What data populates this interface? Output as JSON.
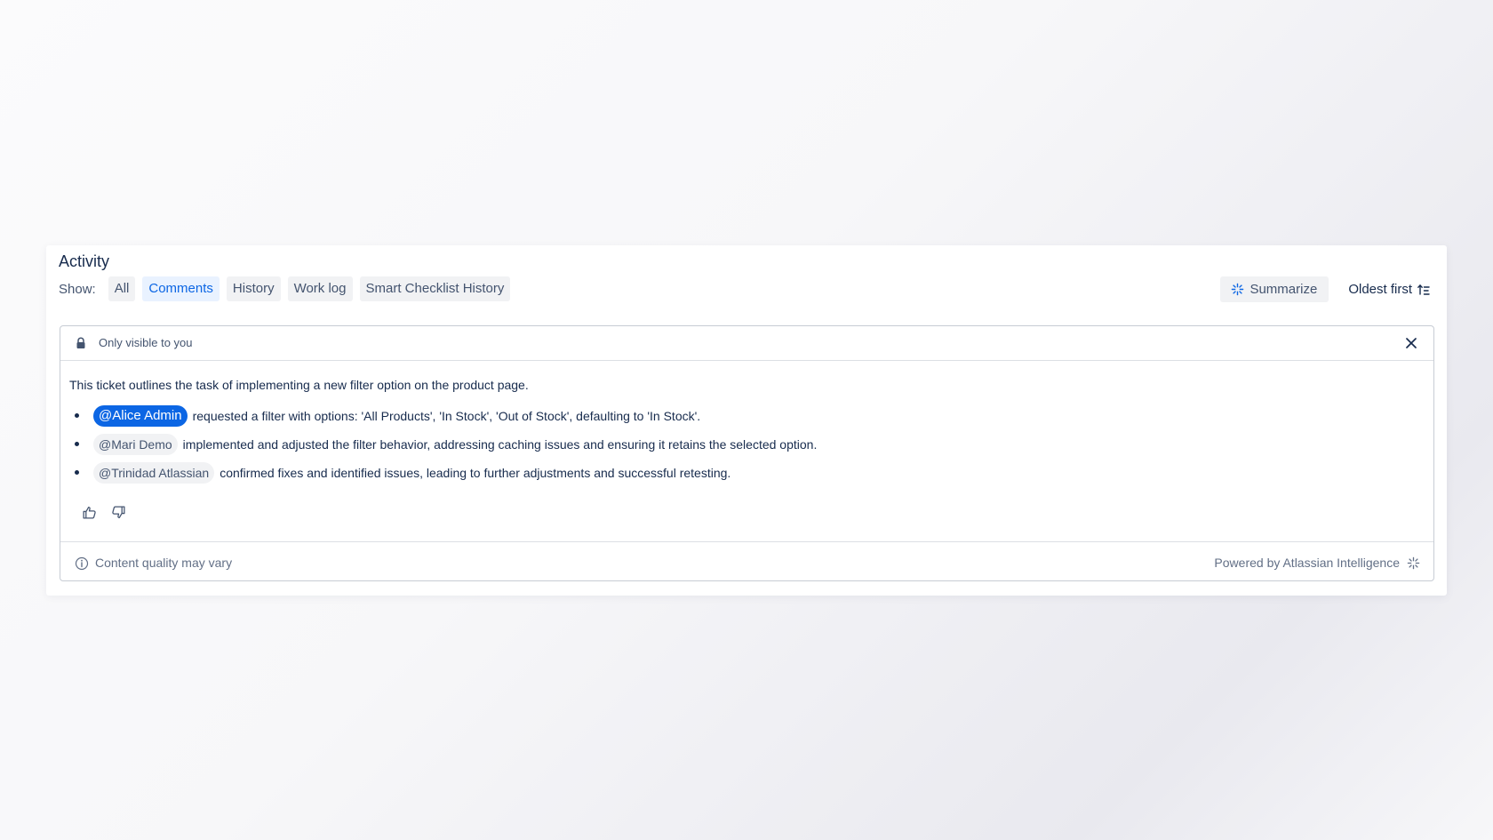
{
  "activity": {
    "title": "Activity",
    "show_label": "Show:",
    "filters": [
      {
        "label": "All",
        "active": false
      },
      {
        "label": "Comments",
        "active": true
      },
      {
        "label": "History",
        "active": false
      },
      {
        "label": "Work log",
        "active": false
      },
      {
        "label": "Smart Checklist History",
        "active": false
      }
    ],
    "summarize_label": "Summarize",
    "sort_label": "Oldest first"
  },
  "summary_card": {
    "visibility": "Only visible to you",
    "summary_text": "This ticket outlines the task of implementing a new filter option on the product page.",
    "bullets": [
      {
        "mention": "@Alice Admin",
        "text": "requested a filter with options: 'All Products', 'In Stock', 'Out of Stock', defaulting to 'In Stock'."
      },
      {
        "mention": "@Mari Demo",
        "text": "implemented and adjusted the filter behavior, addressing caching issues and ensuring it retains the selected option."
      },
      {
        "mention": "@Trinidad Atlassian",
        "text": "confirmed fixes and identified issues, leading to further adjustments and successful retesting."
      }
    ],
    "footer_left": "Content quality may vary",
    "footer_right": "Powered by Atlassian Intelligence"
  },
  "icons": {
    "sparkle": "ai-sparkle-icon",
    "sort": "sort-ascending-icon",
    "lock": "lock-icon",
    "close": "close-icon",
    "thumbs_up": "thumbs-up-icon",
    "thumbs_down": "thumbs-down-icon",
    "info": "info-icon"
  },
  "colors": {
    "accent": "#0c66e4",
    "active_bg": "#e9f2ff",
    "button_bg": "#f1f2f4",
    "text": "#172b4d",
    "subtle_text": "#626f86"
  }
}
